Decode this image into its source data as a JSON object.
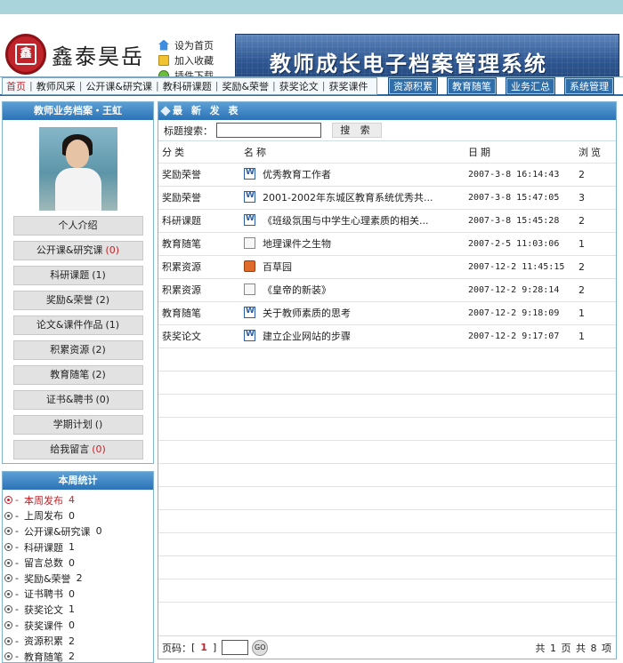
{
  "header": {
    "logo_text": "鑫泰昊岳",
    "logo_seal": "鑫",
    "quick_links": [
      "设为首页",
      "加入收藏",
      "插件下载"
    ],
    "banner_title": "教师成长电子档案管理系统"
  },
  "nav": {
    "items": [
      "首页",
      "教师风采",
      "公开课&研究课",
      "教科研课题",
      "奖励&荣誉",
      "获奖论文",
      "获奖课件"
    ],
    "buttons": [
      "资源积累",
      "教育随笔",
      "业务汇总",
      "系统管理"
    ]
  },
  "profile": {
    "title": "教师业务档案・王虹",
    "menu": [
      {
        "label": "个人介绍",
        "count": ""
      },
      {
        "label": "公开课&研究课",
        "count": "(0)"
      },
      {
        "label": "科研课题",
        "count": "(1)"
      },
      {
        "label": "奖励&荣誉",
        "count": "(2)"
      },
      {
        "label": "论文&课件作品",
        "count": "(1)"
      },
      {
        "label": "积累资源",
        "count": "(2)"
      },
      {
        "label": "教育随笔",
        "count": "(2)"
      },
      {
        "label": "证书&聘书",
        "count": "(0)"
      },
      {
        "label": "学期计划",
        "count": "()"
      },
      {
        "label": "给我留言",
        "count": "(0)"
      }
    ]
  },
  "stats": {
    "title": "本周统计",
    "items": [
      {
        "label": "本周发布",
        "value": "4"
      },
      {
        "label": "上周发布",
        "value": "0"
      },
      {
        "label": "公开课&研究课",
        "value": "0"
      },
      {
        "label": "科研课题",
        "value": "1"
      },
      {
        "label": "留言总数",
        "value": "0"
      },
      {
        "label": "奖励&荣誉",
        "value": "2"
      },
      {
        "label": "证书聘书",
        "value": "0"
      },
      {
        "label": "获奖论文",
        "value": "1"
      },
      {
        "label": "获奖课件",
        "value": "0"
      },
      {
        "label": "资源积累",
        "value": "2"
      },
      {
        "label": "教育随笔",
        "value": "2"
      }
    ]
  },
  "main": {
    "title": "最 新 发 表",
    "search_label": "标题搜索：",
    "search_value": "",
    "search_button": "搜 索",
    "columns": [
      "分类",
      "名称",
      "日期",
      "浏览"
    ],
    "rows": [
      {
        "category": "奖励荣誉",
        "icon": "word-doc-icon",
        "name": "优秀教育工作者",
        "date": "2007-3-8 16:14:43",
        "views": "2"
      },
      {
        "category": "奖励荣誉",
        "icon": "word-doc-icon",
        "name": "2001-2002年东城区教育系统优秀共...",
        "date": "2007-3-8 15:47:05",
        "views": "3"
      },
      {
        "category": "科研课题",
        "icon": "word-doc-icon",
        "name": "《班级氛围与中学生心理素质的相关...",
        "date": "2007-3-8 15:45:28",
        "views": "2"
      },
      {
        "category": "教育随笔",
        "icon": "text-doc-icon",
        "name": "地理课件之生物",
        "date": "2007-2-5 11:03:06",
        "views": "1"
      },
      {
        "category": "积累资源",
        "icon": "presentation-icon",
        "name": "百草园",
        "date": "2007-12-2 11:45:15",
        "views": "2"
      },
      {
        "category": "积累资源",
        "icon": "text-doc-icon",
        "name": "《皇帝的新装》",
        "date": "2007-12-2 9:28:14",
        "views": "2"
      },
      {
        "category": "教育随笔",
        "icon": "word-doc-icon",
        "name": "关于教师素质的思考",
        "date": "2007-12-2 9:18:09",
        "views": "1"
      },
      {
        "category": "获奖论文",
        "icon": "word-doc-icon",
        "name": "建立企业网站的步骤",
        "date": "2007-12-2 9:17:07",
        "views": "1"
      }
    ],
    "pager": {
      "label": "页码：",
      "open_bracket": "[",
      "current": "1",
      "close_bracket": "]",
      "go": "GO",
      "total": "共 1 页 共 8 项"
    }
  }
}
